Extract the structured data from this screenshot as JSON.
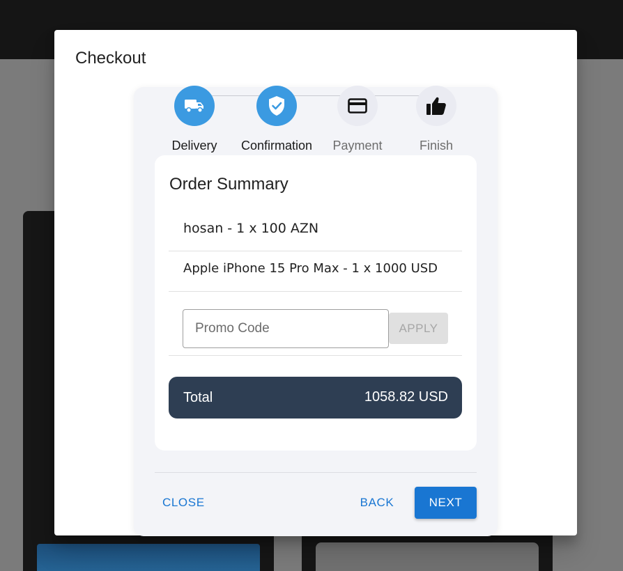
{
  "dialog": {
    "title": "Checkout"
  },
  "stepper": {
    "steps": [
      {
        "label": "Delivery",
        "icon": "truck-icon",
        "state": "active"
      },
      {
        "label": "Confirmation",
        "icon": "shield-check-icon",
        "state": "active"
      },
      {
        "label": "Payment",
        "icon": "credit-card-icon",
        "state": "inactive"
      },
      {
        "label": "Finish",
        "icon": "thumbs-up-icon",
        "state": "inactive"
      }
    ]
  },
  "summary": {
    "title": "Order Summary",
    "items": [
      {
        "text": "hosan - 1 x 100 AZN"
      },
      {
        "text": "Apple iPhone 15 Pro Max - 1 x 1000 USD"
      }
    ],
    "promo": {
      "placeholder": "Promo Code",
      "value": "",
      "apply_label": "APPLY"
    },
    "total": {
      "label": "Total",
      "value": "1058.82 USD"
    }
  },
  "footer": {
    "close_label": "CLOSE",
    "back_label": "BACK",
    "next_label": "NEXT"
  },
  "colors": {
    "accent": "#1976d2",
    "step_active": "#3b9ae1",
    "step_inactive": "#eaebf2",
    "total_bg": "#2e3e53"
  }
}
